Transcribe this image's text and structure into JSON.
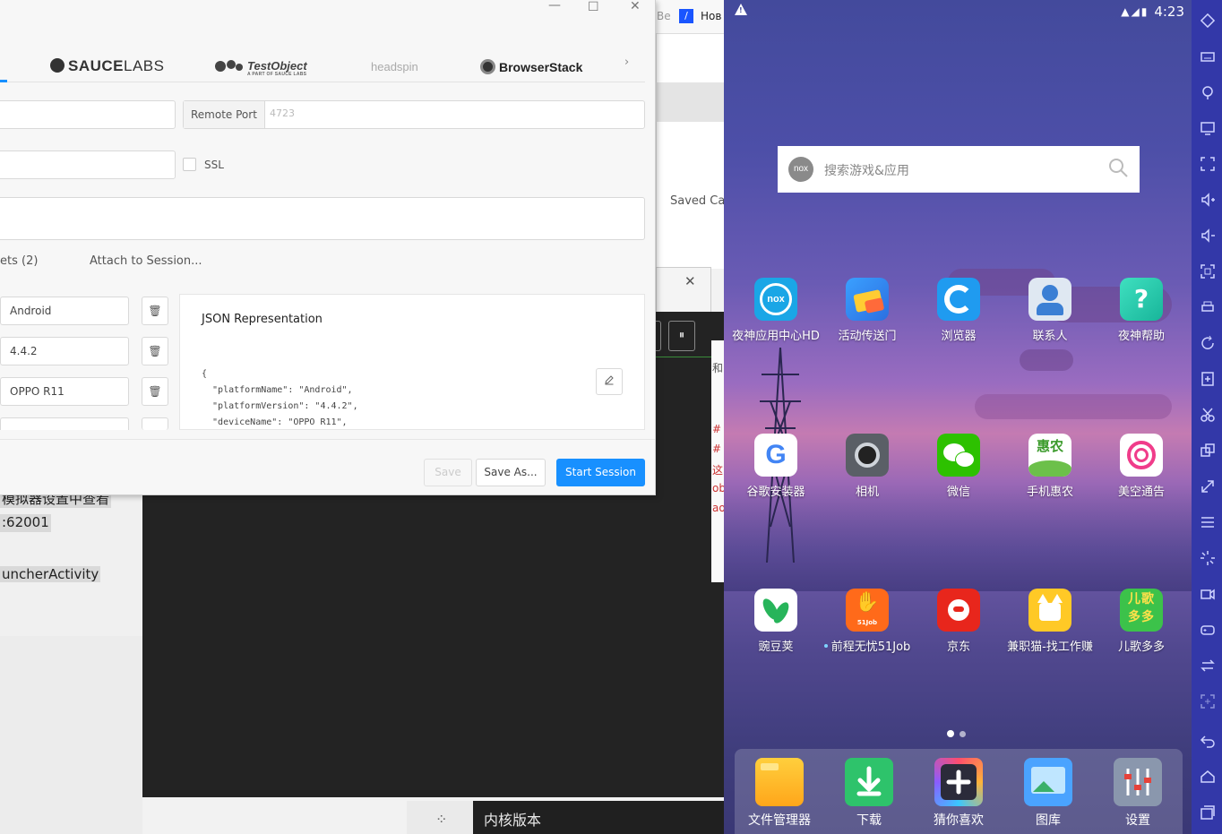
{
  "background": {
    "browser_tab_1": "Be",
    "browser_tab_2": "Нов",
    "saved_caps": "Saved Cap",
    "note_1": "模拟器设置中查看",
    "note_2": ":62001",
    "note_3": "uncherActivity",
    "red_lines": [
      "#",
      "#",
      "这",
      "oba",
      "ao"
    ],
    "cjk_frag": "和",
    "bottom_label": "内核版本"
  },
  "appium": {
    "providers": {
      "saucelabs_bold": "SAUCE",
      "saucelabs_light": "LABS",
      "testobject": "TestObject",
      "testobject_sub": "A PART OF SAUCE LABS",
      "headspin": "headspin",
      "browserstack": "BrowserStack"
    },
    "remote_port_label": "Remote Port",
    "remote_port_placeholder": "4723",
    "ssl_label": "SSL",
    "tabs": {
      "saved": "ets (2)",
      "attach": "Attach to Session..."
    },
    "caps": [
      "Android",
      "4.4.2",
      "OPPO R11"
    ],
    "json_title": "JSON Representation",
    "json_code": "{\n  \"platformName\": \"Android\",\n  \"platformVersion\": \"4.4.2\",\n  \"deviceName\": \"OPPO R11\",",
    "buttons": {
      "save": "Save",
      "save_as": "Save As...",
      "start": "Start Session"
    }
  },
  "android": {
    "status_time": "4:23",
    "search_placeholder": "搜索游戏&应用",
    "nox_logo": "nox",
    "apps_row1": [
      "夜神应用中心HD",
      "活动传送门",
      "浏览器",
      "联系人",
      "夜神帮助"
    ],
    "apps_row2": [
      "谷歌安装器",
      "相机",
      "微信",
      "手机惠农",
      "美空通告"
    ],
    "apps_row3": [
      "豌豆荚",
      "前程无忧51Job",
      "京东",
      "兼职猫-找工作赚",
      "儿歌多多"
    ],
    "dock": [
      "文件管理器",
      "下载",
      "猜你喜欢",
      "图库",
      "设置"
    ],
    "icon_text": {
      "huinong": "惠农",
      "erge": "儿歌多多",
      "job51": "51Job"
    }
  },
  "colors": {
    "primary": "#1890ff",
    "toolbar": "#3338a8"
  }
}
